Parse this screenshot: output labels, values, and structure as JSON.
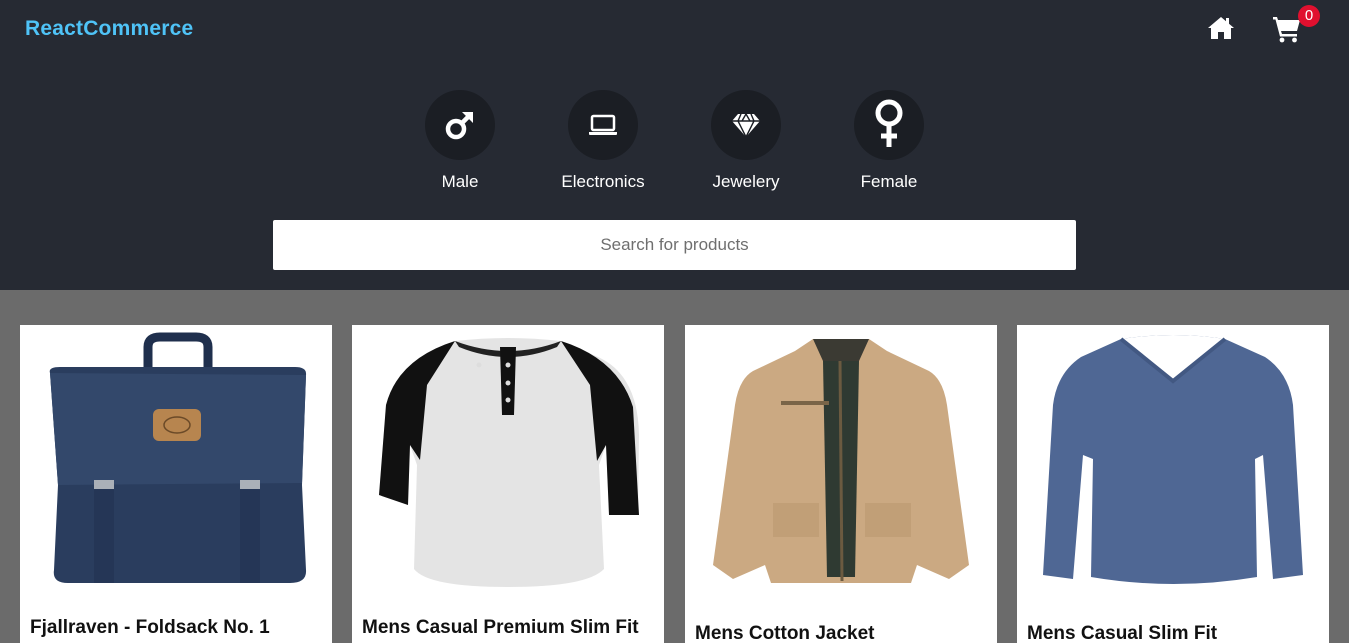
{
  "brand": "ReactCommerce",
  "nav": {
    "home_icon": "home-icon",
    "cart_icon": "shopping-cart-icon",
    "cart_count": "0"
  },
  "categories": [
    {
      "label": "Male",
      "icon": "male-symbol-icon"
    },
    {
      "label": "Electronics",
      "icon": "laptop-icon"
    },
    {
      "label": "Jewelery",
      "icon": "diamond-icon"
    },
    {
      "label": "Female",
      "icon": "female-symbol-icon"
    }
  ],
  "search": {
    "placeholder": "Search for products",
    "value": ""
  },
  "products": [
    {
      "title": "Fjallraven - Foldsack No. 1",
      "image": "navy-backpack"
    },
    {
      "title": "Mens Casual Premium Slim Fit",
      "image": "raglan-henley-tshirt"
    },
    {
      "title": "Mens Cotton Jacket",
      "image": "khaki-cotton-jacket"
    },
    {
      "title": "Mens Casual Slim Fit",
      "image": "blue-long-sleeve-tee"
    }
  ],
  "colors": {
    "header_bg": "#262a33",
    "brand": "#4fc3f7",
    "badge": "#e0102f",
    "page_bg": "#6b6b6b"
  }
}
